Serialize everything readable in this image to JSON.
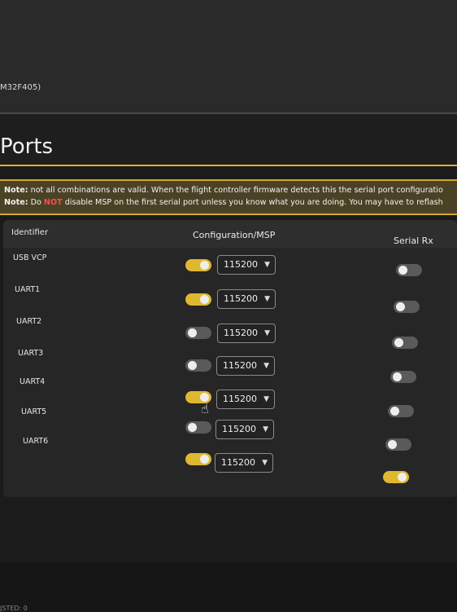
{
  "app": {
    "device_label": "M32F405)",
    "page_title": "Ports",
    "bottom_text": "JSTED: 0"
  },
  "notes": {
    "line1_prefix": "Note:",
    "line1_text": " not all combinations are valid. When the flight controller firmware detects this the serial port configuratio",
    "line2_prefix": "Note:",
    "line2_text_a": " Do ",
    "line2_warn": "NOT",
    "line2_text_b": " disable MSP on the first serial port unless you know what you are doing. You may have to reflash"
  },
  "table": {
    "headers": {
      "identifier": "Identifier",
      "configuration": "Configuration/MSP",
      "serial_rx": "Serial Rx"
    },
    "rows": [
      {
        "id": "USB VCP",
        "msp_on": true,
        "baud": "115200",
        "serial_rx_on": false
      },
      {
        "id": "UART1",
        "msp_on": true,
        "baud": "115200",
        "serial_rx_on": false
      },
      {
        "id": "UART2",
        "msp_on": false,
        "baud": "115200",
        "serial_rx_on": false
      },
      {
        "id": "UART3",
        "msp_on": false,
        "baud": "115200",
        "serial_rx_on": false
      },
      {
        "id": "UART4",
        "msp_on": true,
        "baud": "115200",
        "serial_rx_on": false
      },
      {
        "id": "UART5",
        "msp_on": false,
        "baud": "115200",
        "serial_rx_on": false
      },
      {
        "id": "UART6",
        "msp_on": true,
        "baud": "115200",
        "serial_rx_on": true
      }
    ]
  },
  "icons": {
    "caret": "chevron-down-icon",
    "cursor": "hand-pointer-icon"
  },
  "colors": {
    "accent": "#e0b830",
    "warning": "#ff4a4a",
    "note_bg": "#4b4226"
  }
}
